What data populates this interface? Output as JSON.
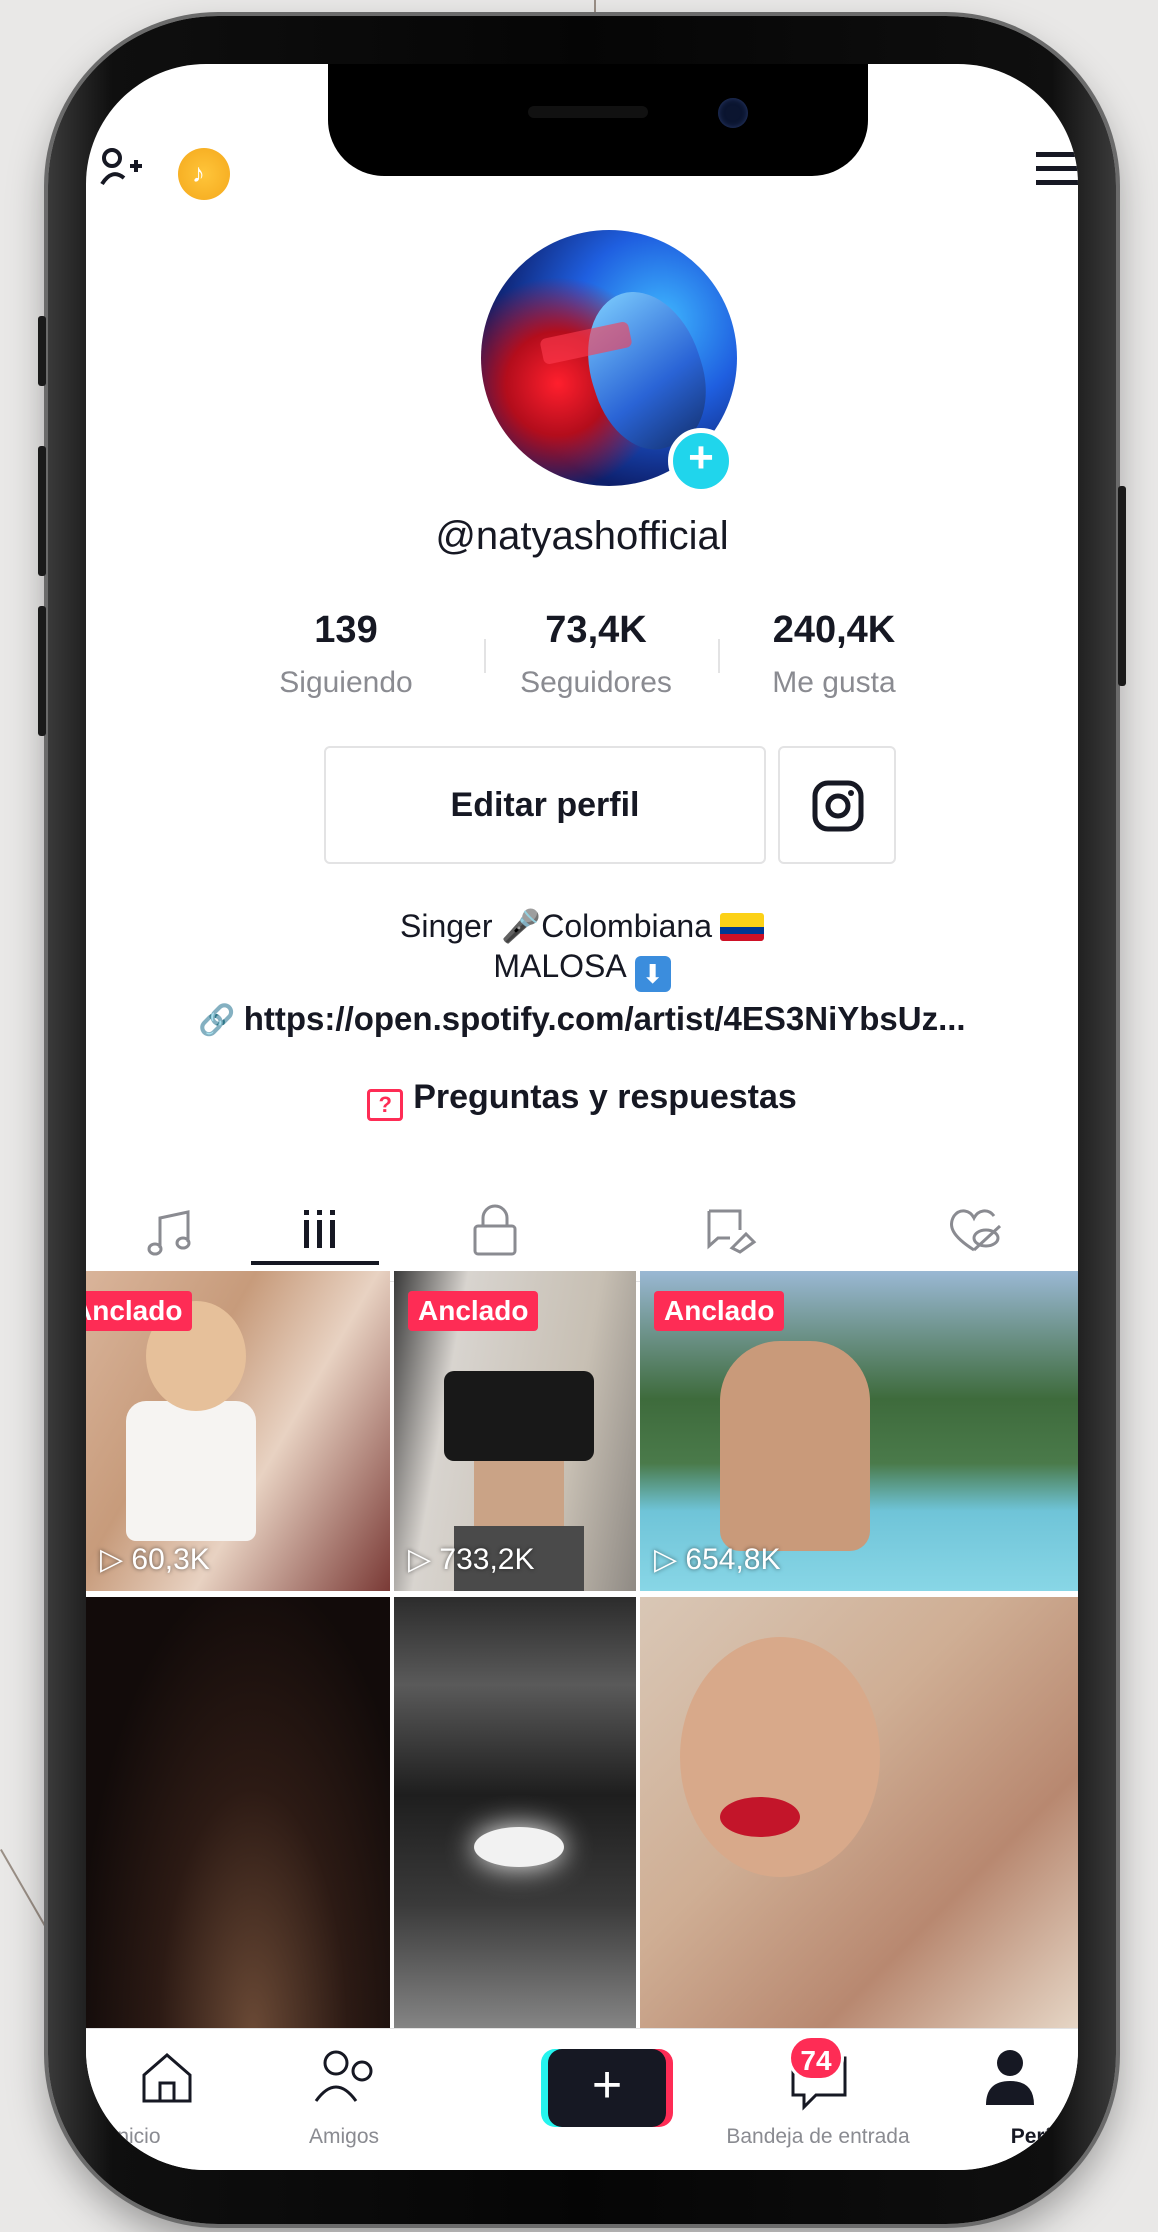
{
  "top_bar": {
    "add_user_icon": "add-user-icon",
    "coin_icon": "coin-icon",
    "menu_icon": "hamburger-menu-icon"
  },
  "profile": {
    "username": "@natyashofficial",
    "stats": [
      {
        "value": "139",
        "label": "Siguiendo"
      },
      {
        "value": "73,4K",
        "label": "Seguidores"
      },
      {
        "value": "240,4K",
        "label": "Me gusta"
      }
    ],
    "edit_button": "Editar perfil",
    "bio_line1": "Singer 🎤Colombiana",
    "bio_line2": "MALOSA",
    "link": "https://open.spotify.com/artist/4ES3NiYbsUz...",
    "qa": "Preguntas y respuestas"
  },
  "tabs": [
    {
      "icon": "music-note-icon"
    },
    {
      "icon": "grid-icon",
      "active": true
    },
    {
      "icon": "lock-icon"
    },
    {
      "icon": "tagged-icon"
    },
    {
      "icon": "liked-hidden-icon"
    }
  ],
  "videos": [
    {
      "pinned": "Anclado",
      "views": "60,3K"
    },
    {
      "pinned": "Anclado",
      "views": "733,2K"
    },
    {
      "pinned": "Anclado",
      "views": "654,8K"
    },
    {
      "pinned": "",
      "views": ""
    },
    {
      "pinned": "",
      "views": ""
    },
    {
      "pinned": "",
      "views": ""
    }
  ],
  "nav": {
    "home": "Inicio",
    "friends": "Amigos",
    "inbox": "Bandeja de entrada",
    "inbox_badge": "74",
    "profile": "Perfil"
  },
  "colors": {
    "accent": "#fe2c55",
    "cyan": "#20d5ec",
    "text": "#161823",
    "muted": "#8a8b91"
  }
}
